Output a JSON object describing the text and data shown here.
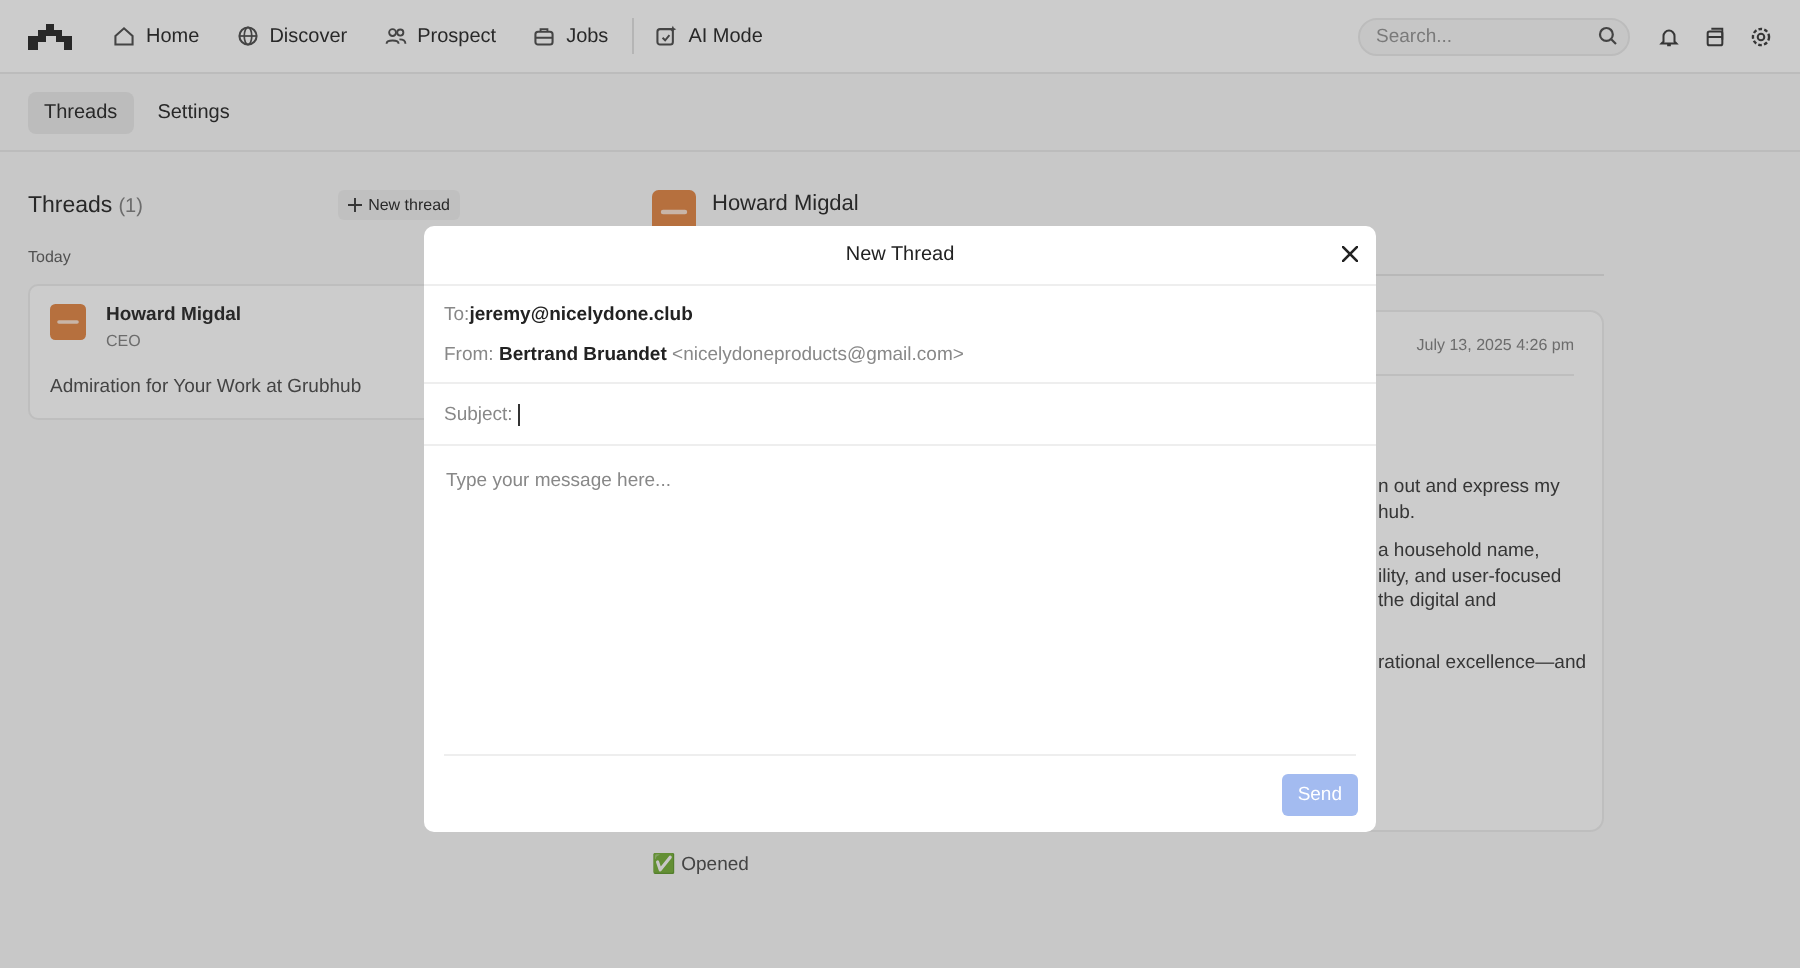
{
  "nav": {
    "items": [
      "Home",
      "Discover",
      "Prospect",
      "Jobs",
      "AI Mode"
    ],
    "search": {
      "placeholder": "Search..."
    }
  },
  "subnav": {
    "tabs": [
      {
        "label": "Threads",
        "selected": true
      },
      {
        "label": "Settings",
        "selected": false
      }
    ]
  },
  "threads": {
    "title": "Threads",
    "count": "(1)",
    "new_button": "New thread",
    "groups": [
      {
        "label": "Today",
        "items": [
          {
            "name": "Howard Migdal",
            "role": "CEO",
            "subject": "Admiration for Your Work at Grubhub"
          }
        ]
      }
    ]
  },
  "conversation": {
    "contact": {
      "name": "Howard Migdal"
    },
    "message": {
      "date": "July 13, 2025 4:26 pm",
      "paragraphs": [
        [
          "n out and express my",
          "hub."
        ],
        [
          "a household name,",
          "ility, and user-focused",
          "the digital and"
        ],
        [
          "rational excellence—and"
        ]
      ]
    },
    "status": "✅ Opened"
  },
  "compose": {
    "title": "New Thread",
    "to_label": "To:",
    "to": "jeremy@nicelydone.club",
    "from_label": "From:",
    "from_name": "Bertrand Bruandet",
    "from_email": "<nicelydoneproducts@gmail.com>",
    "subject_label": "Subject:",
    "message_placeholder": "Type your message here...",
    "send": {
      "label": "Send",
      "disabled": true
    }
  }
}
